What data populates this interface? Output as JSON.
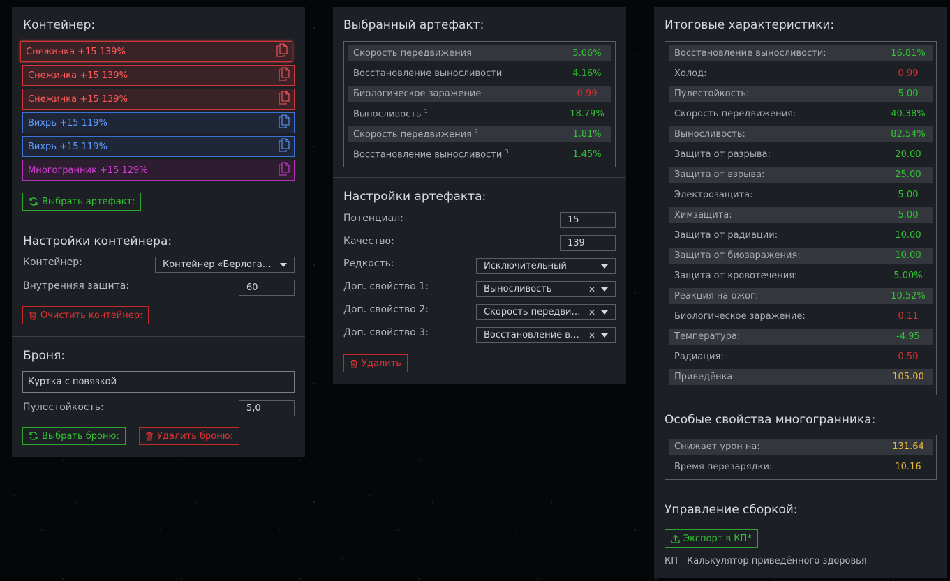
{
  "container": {
    "title": "Контейнер:",
    "items": [
      {
        "name": "Снежинка +15 139%",
        "color": "red"
      },
      {
        "name": "Снежинка +15 139%",
        "color": "red"
      },
      {
        "name": "Снежинка +15 139%",
        "color": "red"
      },
      {
        "name": "Вихрь +15 119%",
        "color": "blue"
      },
      {
        "name": "Вихрь +15 119%",
        "color": "blue"
      },
      {
        "name": "Многогранник +15 129%",
        "color": "purple"
      }
    ],
    "select_button": "Выбрать артефакт:"
  },
  "container_settings": {
    "title": "Настройки контейнера:",
    "container_label": "Контейнер:",
    "container_value": "Контейнер «Берлога…",
    "inner_protection_label": "Внутренняя защита:",
    "inner_protection_value": "60",
    "clear_button": "Очистить контейнер:"
  },
  "armor": {
    "title": "Броня:",
    "armor_value": "Куртка с повязкой",
    "bulletproof_label": "Пулестойкость:",
    "bulletproof_value": "5,0",
    "select_button": "Выбрать броню:",
    "delete_button": "Удалить броню:"
  },
  "selected_artifact": {
    "title": "Выбранный артефакт:",
    "rows": [
      {
        "label": "Скорость передвижения",
        "sup": "",
        "value": "5.06%",
        "color": "g"
      },
      {
        "label": "Восстановление выносливости",
        "sup": "",
        "value": "4.16%",
        "color": "g"
      },
      {
        "label": "Биологическое заражение",
        "sup": "",
        "value": "0.99",
        "color": "r"
      },
      {
        "label": "Выносливость",
        "sup": "1",
        "value": "18.79%",
        "color": "g"
      },
      {
        "label": "Скорость передвижения",
        "sup": "2",
        "value": "1.81%",
        "color": "g"
      },
      {
        "label": "Восстановление выносливости",
        "sup": "3",
        "value": "1.45%",
        "color": "g"
      }
    ]
  },
  "artifact_settings": {
    "title": "Настройки артефакта:",
    "potential_label": "Потенциал:",
    "potential_value": "15",
    "quality_label": "Качество:",
    "quality_value": "139",
    "rarity_label": "Редкость:",
    "rarity_value": "Исключительный",
    "prop1_label": "Доп. свойство 1:",
    "prop1_value": "Выносливость",
    "prop2_label": "Доп. свойство 2:",
    "prop2_value": "Скорость передви…",
    "prop3_label": "Доп. свойство 3:",
    "prop3_value": "Восстановление в…",
    "delete_button": "Удалить"
  },
  "totals": {
    "title": "Итоговые характеристики:",
    "rows": [
      {
        "label": "Восстановление выносливости:",
        "value": "16.81%",
        "color": "g"
      },
      {
        "label": "Холод:",
        "value": "0.99",
        "color": "r"
      },
      {
        "label": "Пулестойкость:",
        "value": "5.00",
        "color": "g"
      },
      {
        "label": "Скорость передвижения:",
        "value": "40.38%",
        "color": "g"
      },
      {
        "label": "Выносливость:",
        "value": "82.54%",
        "color": "g"
      },
      {
        "label": "Защита от разрыва:",
        "value": "20.00",
        "color": "g"
      },
      {
        "label": "Защита от взрыва:",
        "value": "25.00",
        "color": "g"
      },
      {
        "label": "Электрозащита:",
        "value": "5.00",
        "color": "g"
      },
      {
        "label": "Химзащита:",
        "value": "5.00",
        "color": "g"
      },
      {
        "label": "Защита от радиации:",
        "value": "10.00",
        "color": "g"
      },
      {
        "label": "Защита от биозаражения:",
        "value": "10.00",
        "color": "g"
      },
      {
        "label": "Защита от кровотечения:",
        "value": "5.00%",
        "color": "g"
      },
      {
        "label": "Реакция на ожог:",
        "value": "10.52%",
        "color": "g"
      },
      {
        "label": "Биологическое заражение:",
        "value": "0.11",
        "color": "r"
      },
      {
        "label": "Температура:",
        "value": "-4.95",
        "color": "g"
      },
      {
        "label": "Радиация:",
        "value": "0.50",
        "color": "r"
      },
      {
        "label": "Приведёнка",
        "value": "105.00",
        "color": "y"
      }
    ]
  },
  "polyhedron": {
    "title": "Особые свойства многогранника:",
    "rows": [
      {
        "label": "Снижает урон на:",
        "value": "131.64",
        "color": "y"
      },
      {
        "label": "Время перезарядки:",
        "value": "10.16",
        "color": "y"
      }
    ]
  },
  "build": {
    "title": "Управление сборкой:",
    "export_button": "Экспорт в КП*",
    "footnote": "КП - Калькулятор приведённого здоровья"
  },
  "colors": {
    "green": "#33c233",
    "red": "#d63030",
    "yellow": "#e6b93a",
    "panel": "#1c1f24"
  }
}
